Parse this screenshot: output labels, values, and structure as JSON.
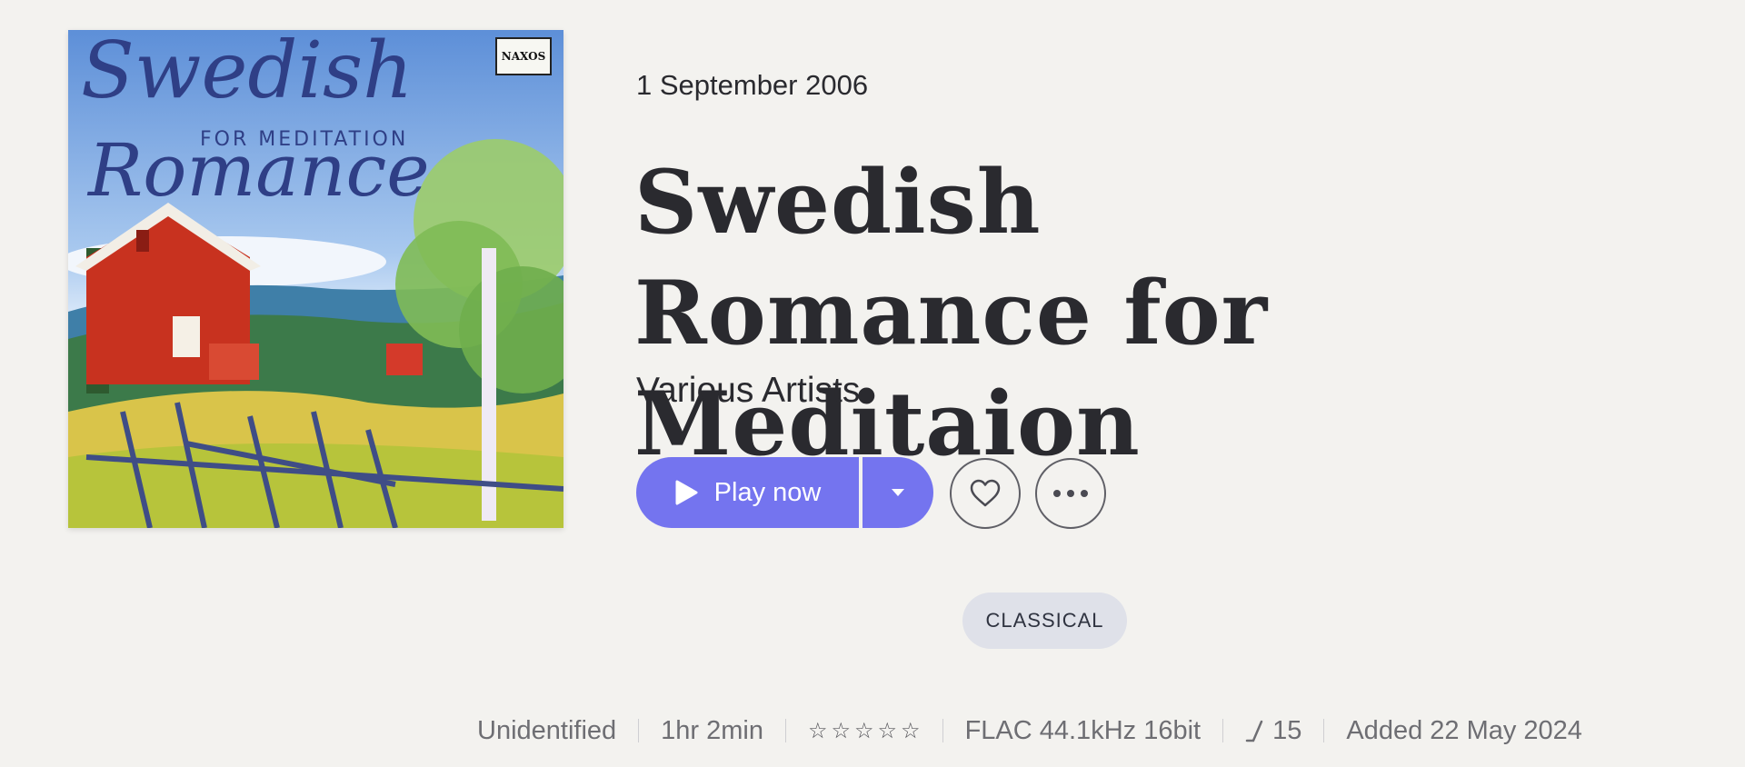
{
  "album": {
    "cover": {
      "title_line1": "Swedish",
      "subtitle": "FOR MEDITATION",
      "title_line2": "Romance",
      "label": "NAXOS"
    },
    "release_date": "1 September 2006",
    "title": "Swedish Romance for Meditaion",
    "artist": "Various Artists"
  },
  "actions": {
    "play_label": "Play now",
    "play_icon": "play-icon",
    "more_options_icon": "caret-down-icon",
    "favorite_icon": "heart-icon",
    "menu_icon": "ellipsis-icon"
  },
  "genres": [
    "CLASSICAL"
  ],
  "meta": {
    "status": "Unidentified",
    "duration": "1hr 2min",
    "rating": 0,
    "rating_max": 5,
    "format": "FLAC 44.1kHz 16bit",
    "track_count": "15",
    "added": "Added 22 May 2024"
  },
  "colors": {
    "accent": "#7474ef",
    "background": "#f3f2ef",
    "tag_background": "#dfe1e9",
    "text": "#2a2a2f",
    "muted_text": "#6e6e73"
  }
}
